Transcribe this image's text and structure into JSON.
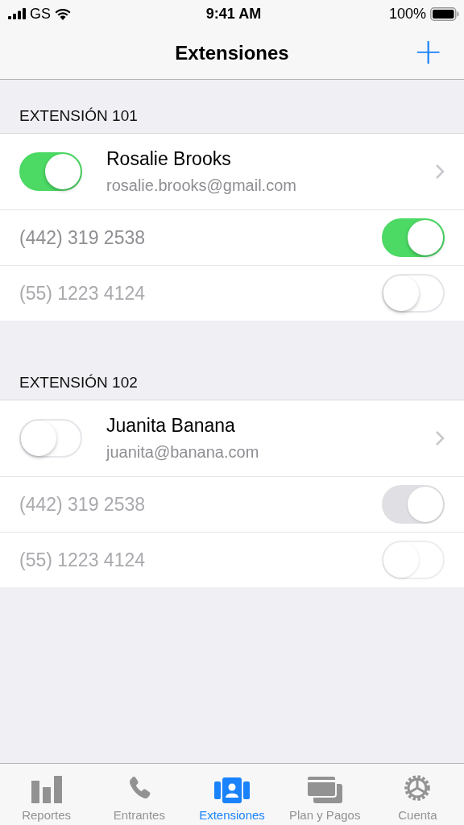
{
  "status_bar": {
    "carrier": "GS",
    "time": "9:41 AM",
    "battery": "100%"
  },
  "nav": {
    "title": "Extensiones",
    "add_button": "+"
  },
  "extensions": [
    {
      "header": "EXTENSIÓN 101",
      "member": {
        "name": "Rosalie Brooks",
        "email": "rosalie.brooks@gmail.com",
        "on": true
      },
      "phones": [
        {
          "number": "(442) 319 2538",
          "on": true,
          "disabled": false
        },
        {
          "number": "(55) 1223 4124",
          "on": false,
          "disabled": false
        }
      ]
    },
    {
      "header": "EXTENSIÓN 102",
      "member": {
        "name": "Juanita Banana",
        "email": "juanita@banana.com",
        "on": false
      },
      "phones": [
        {
          "number": "(442) 319 2538",
          "on": true,
          "disabled": true
        },
        {
          "number": "(55) 1223 4124",
          "on": false,
          "disabled": true
        }
      ]
    }
  ],
  "tabs": [
    {
      "label": "Reportes",
      "kind": "bars",
      "selected": false
    },
    {
      "label": "Entrantes",
      "kind": "phone",
      "selected": false
    },
    {
      "label": "Extensiones",
      "kind": "contacts",
      "selected": true
    },
    {
      "label": "Plan y Pagos",
      "kind": "cards",
      "selected": false
    },
    {
      "label": "Cuenta",
      "kind": "gear",
      "selected": false
    }
  ]
}
